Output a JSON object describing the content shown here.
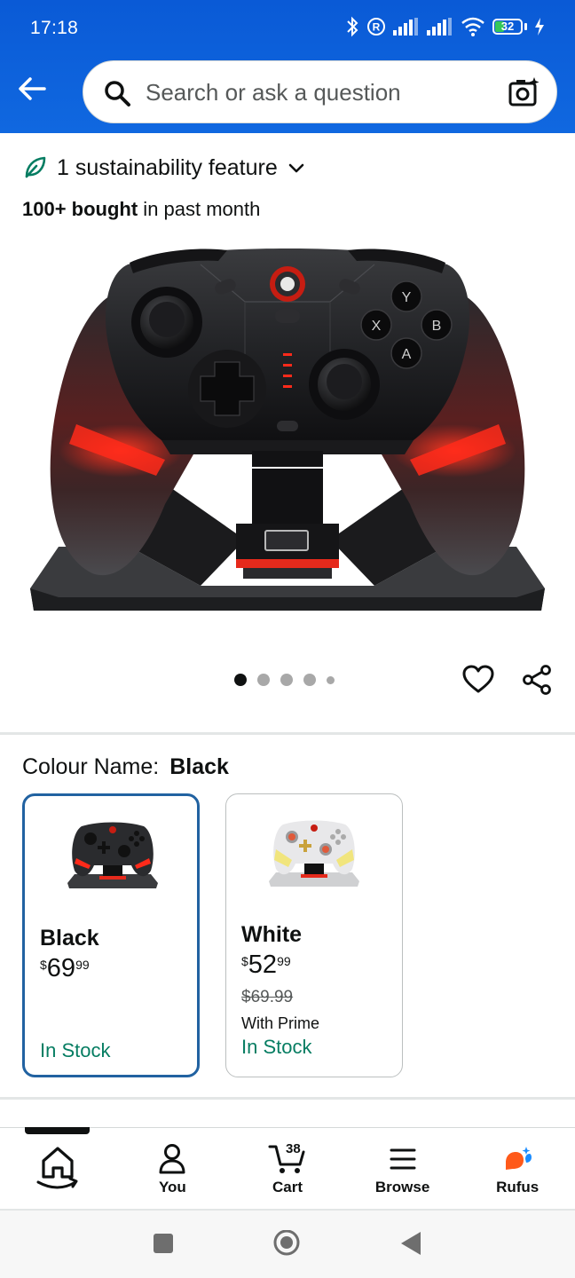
{
  "status_bar": {
    "time": "17:18",
    "battery": "32",
    "battery_level": 0.32
  },
  "search": {
    "placeholder": "Search or ask a question"
  },
  "sustainability": {
    "label": "1 sustainability feature"
  },
  "bought": {
    "bold": "100+ bought",
    "rest": " in past month"
  },
  "carousel": {
    "total": 5,
    "active": 0
  },
  "colour": {
    "label": "Colour Name:",
    "selected": "Black",
    "options": [
      {
        "name": "Black",
        "price_symbol": "$",
        "price_whole": "69",
        "price_fraction": "99",
        "stock": "In Stock"
      },
      {
        "name": "White",
        "price_symbol": "$",
        "price_whole": "52",
        "price_fraction": "99",
        "list_price": "$69.99",
        "prime_note": "With Prime",
        "stock": "In Stock"
      }
    ]
  },
  "nav": {
    "items": [
      {
        "label": ""
      },
      {
        "label": "You"
      },
      {
        "label": "Cart",
        "count": "38"
      },
      {
        "label": "Browse"
      },
      {
        "label": "Rufus"
      }
    ]
  },
  "colors": {
    "header": "#0a5ad6",
    "selected_border": "#2162a1",
    "stock_green": "#067d62",
    "accent_red": "#ff2a1a"
  }
}
